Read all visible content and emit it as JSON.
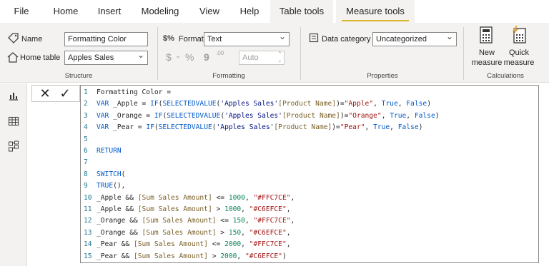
{
  "menu": [
    "File",
    "Home",
    "Insert",
    "Modeling",
    "View",
    "Help",
    "Table tools",
    "Measure tools"
  ],
  "ribbon": {
    "structure": {
      "name_label": "Name",
      "name_value": "Formatting Color",
      "home_table_label": "Home table",
      "home_table_value": "Apples Sales",
      "group_label": "Structure"
    },
    "formatting": {
      "format_label": "Format",
      "format_value": "Text",
      "currency_symbol": "$",
      "percent_symbol": "%",
      "comma_symbol": "9",
      "decimal_symbol": ".00",
      "auto_value": "Auto",
      "group_label": "Formatting"
    },
    "properties": {
      "data_category_label": "Data category",
      "data_category_value": "Uncategorized",
      "group_label": "Properties"
    },
    "calculations": {
      "new_measure_line1": "New",
      "new_measure_line2": "measure",
      "quick_measure_line1": "Quick",
      "quick_measure_line2": "measure",
      "group_label": "Calculations"
    }
  },
  "formula_bar": {
    "cancel_symbol": "✕",
    "commit_symbol": "✓"
  },
  "code_lines": [
    {
      "n": "1",
      "text": "Formatting Color ="
    },
    {
      "n": "2",
      "text": "VAR _Apple = IF(SELECTEDVALUE('Apples Sales'[Product Name])=\"Apple\", True, False)"
    },
    {
      "n": "3",
      "text": "VAR _Orange = IF(SELECTEDVALUE('Apples Sales'[Product Name])=\"Orange\", True, False)"
    },
    {
      "n": "4",
      "text": "VAR _Pear = IF(SELECTEDVALUE('Apples Sales'[Product Name])=\"Pear\", True, False)"
    },
    {
      "n": "5",
      "text": ""
    },
    {
      "n": "6",
      "text": "RETURN"
    },
    {
      "n": "7",
      "text": ""
    },
    {
      "n": "8",
      "text": "SWITCH("
    },
    {
      "n": "9",
      "text": "TRUE(),"
    },
    {
      "n": "10",
      "text": "_Apple && [Sum Sales Amount] <= 1000, \"#FFC7CE\","
    },
    {
      "n": "11",
      "text": "_Apple && [Sum Sales Amount] > 1000, \"#C6EFCE\","
    },
    {
      "n": "12",
      "text": "_Orange && [Sum Sales Amount] <= 150, \"#FFC7CE\","
    },
    {
      "n": "13",
      "text": "_Orange && [Sum Sales Amount] > 150, \"#C6EFCE\","
    },
    {
      "n": "14",
      "text": "_Pear && [Sum Sales Amount] <= 2000, \"#FFC7CE\","
    },
    {
      "n": "15",
      "text": "_Pear && [Sum Sales Amount] > 2000, \"#C6EFCE\")"
    }
  ],
  "colors": {
    "accent_underline": "#d8b82a",
    "keyword": "#035aca",
    "string": "#a31515",
    "number": "#098658",
    "line_number": "#237893"
  },
  "icons": {
    "report": "report-view-icon",
    "data": "table-view-icon",
    "model": "model-view-icon"
  }
}
